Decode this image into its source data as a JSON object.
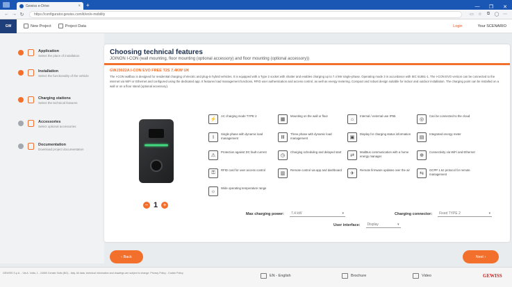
{
  "browser": {
    "tab_title": "Gewiss e-Drive",
    "url": "https://configurator.gewiss.com/it/en/e-mobility",
    "window_controls": [
      "—",
      "❐",
      "✕"
    ]
  },
  "header": {
    "logo_text": "GW",
    "new_project_label": "New Project",
    "project_data_label": "Project Data",
    "login_label": "Login",
    "language_label": "Your SCENARIO"
  },
  "sidebar": {
    "steps": [
      {
        "title": "Application",
        "subtitle": "Select the place of installation"
      },
      {
        "title": "Installation",
        "subtitle": "Select the functionality of the vehicle"
      },
      {
        "title": "Charging stations",
        "subtitle": "Select the technical features"
      },
      {
        "title": "Accessories",
        "subtitle": "Select optional accessories"
      },
      {
        "title": "Documentation",
        "subtitle": "Download project documentation"
      }
    ]
  },
  "main": {
    "title": "Choosing technical features",
    "subtitle": "JOINON I-CON (wall mounting, floor mounting (optional accessory) and floor mounting (optional accessory))",
    "product_name": "GWJ3022A I-CON EVO FREE T2S 7.4KW UK",
    "description": "The I-CON wallbox is designed for residential charging of electric and plug-in hybrid vehicles. It is equipped with a Type 2 socket with shutter and enables charging up to 7.4 kW single-phase. Operating mode 3 in accordance with IEC 61851-1. The I-CON EVO version can be connected to the internet via WiFi or Ethernet and configured using the dedicated app. It features load management functions, RFID user authentication and access control, as well as energy metering. Compact and robust design suitable for indoor and outdoor installation. The charging point can be installed on a wall or on a floor stand (optional accessory).",
    "quantity": "1",
    "qty_minus": "−",
    "qty_plus": "+",
    "features": [
      {
        "icon": "⚡",
        "text": "AC charging mode TYPE 2"
      },
      {
        "icon": "▦",
        "text": "Mounting on the wall or floor"
      },
      {
        "icon": "⌂",
        "text": "Internal / external use IP55"
      },
      {
        "icon": "◎",
        "text": "Can be connected to the cloud"
      },
      {
        "icon": "Ⅰ",
        "text": "Single phase with dynamic load management"
      },
      {
        "icon": "Ⅲ",
        "text": "Three phase with dynamic load management"
      },
      {
        "icon": "▣",
        "text": "Display for charging status information"
      },
      {
        "icon": "▤",
        "text": "Integrated energy meter"
      },
      {
        "icon": "⚠",
        "text": "Protection against DC fault current"
      },
      {
        "icon": "◷",
        "text": "Charging scheduling and delayed start"
      },
      {
        "icon": "⇄",
        "text": "ModBus communication with a home energy manager"
      },
      {
        "icon": "⊕",
        "text": "Connectivity via WiFi and Ethernet"
      },
      {
        "icon": "⚿",
        "text": "RFID card for user access control"
      },
      {
        "icon": "▥",
        "text": "Remote control via app and dashboard"
      },
      {
        "icon": "✈",
        "text": "Remote firmware updates over the air"
      },
      {
        "icon": "⇆",
        "text": "OCPP 1.6J protocol for remote management"
      },
      {
        "icon": "☼",
        "text": "Wide operating temperature range"
      }
    ],
    "max_power_label": "Max charging power:",
    "max_power_value": "7.4 kW",
    "connector_label": "Charging connector:",
    "connector_value": "Fixed TYPE 2",
    "ui_label": "User interface:",
    "ui_value": "Display"
  },
  "buttons": {
    "back": "‹ Back",
    "next": "Next ›"
  },
  "footer": {
    "legal": "GEWISS S.p.A. - Via A. Volta, 1 - 24069 Cenate Sotto (BG) - Italy. All data, technical information and drawings are subject to change. Privacy Policy - Cookie Policy",
    "language": "EN - English",
    "brochure": "Brochure",
    "video": "Video",
    "brand": "GEWISS"
  }
}
